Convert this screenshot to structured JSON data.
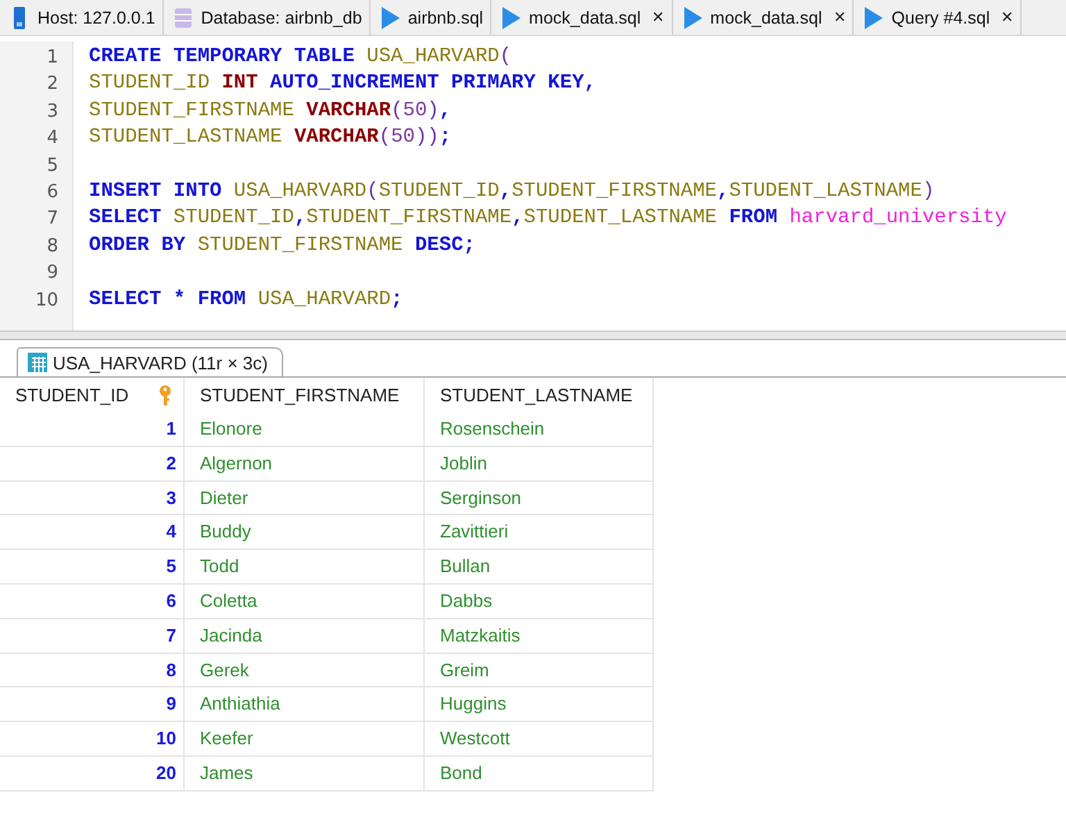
{
  "tabs": [
    {
      "kind": "host",
      "label": "Host: 127.0.0.1"
    },
    {
      "kind": "database",
      "label": "Database: airbnb_db"
    },
    {
      "kind": "file",
      "label": "airbnb.sql"
    },
    {
      "kind": "file",
      "label": "mock_data.sql",
      "close": "✕"
    },
    {
      "kind": "file",
      "label": "mock_data.sql",
      "close": "✕"
    },
    {
      "kind": "file",
      "label": "Query #4.sql",
      "close": "✕"
    }
  ],
  "editor": {
    "lines": [
      {
        "number": "1",
        "tokens": [
          {
            "kind": "keyword",
            "text": "CREATE TEMPORARY TABLE "
          },
          {
            "kind": "identifier",
            "text": "USA_HARVARD"
          },
          {
            "kind": "punct",
            "text": "("
          }
        ]
      },
      {
        "number": "2",
        "tokens": [
          {
            "kind": "identifier",
            "text": "STUDENT_ID "
          },
          {
            "kind": "type",
            "text": "INT "
          },
          {
            "kind": "keyword",
            "text": "AUTO_INCREMENT PRIMARY KEY,"
          }
        ]
      },
      {
        "number": "3",
        "tokens": [
          {
            "kind": "identifier",
            "text": "STUDENT_FIRSTNAME "
          },
          {
            "kind": "type",
            "text": "VARCHAR"
          },
          {
            "kind": "punct",
            "text": "("
          },
          {
            "kind": "number",
            "text": "50"
          },
          {
            "kind": "punct",
            "text": ")"
          },
          {
            "kind": "keyword",
            "text": ","
          }
        ]
      },
      {
        "number": "4",
        "tokens": [
          {
            "kind": "identifier",
            "text": "STUDENT_LASTNAME "
          },
          {
            "kind": "type",
            "text": "VARCHAR"
          },
          {
            "kind": "punct",
            "text": "("
          },
          {
            "kind": "number",
            "text": "50"
          },
          {
            "kind": "punct",
            "text": "))"
          },
          {
            "kind": "keyword",
            "text": ";"
          }
        ]
      },
      {
        "number": "5"
      },
      {
        "number": "6",
        "tokens": [
          {
            "kind": "keyword",
            "text": "INSERT INTO "
          },
          {
            "kind": "identifier",
            "text": "USA_HARVARD"
          },
          {
            "kind": "punct",
            "text": "("
          },
          {
            "kind": "identifier",
            "text": "STUDENT_ID"
          },
          {
            "kind": "keyword",
            "text": ","
          },
          {
            "kind": "identifier",
            "text": "STUDENT_FIRSTNAME"
          },
          {
            "kind": "keyword",
            "text": ","
          },
          {
            "kind": "identifier",
            "text": "STUDENT_LASTNAME"
          },
          {
            "kind": "punct",
            "text": ")"
          }
        ]
      },
      {
        "number": "7",
        "tokens": [
          {
            "kind": "keyword",
            "text": "SELECT "
          },
          {
            "kind": "identifier",
            "text": "STUDENT_ID"
          },
          {
            "kind": "keyword",
            "text": ","
          },
          {
            "kind": "identifier",
            "text": "STUDENT_FIRSTNAME"
          },
          {
            "kind": "keyword",
            "text": ","
          },
          {
            "kind": "identifier",
            "text": "STUDENT_LASTNAME "
          },
          {
            "kind": "keyword",
            "text": "FROM "
          },
          {
            "kind": "table",
            "text": "harvard_university"
          }
        ]
      },
      {
        "number": "8",
        "tokens": [
          {
            "kind": "keyword",
            "text": "ORDER BY "
          },
          {
            "kind": "identifier",
            "text": "STUDENT_FIRSTNAME "
          },
          {
            "kind": "keyword",
            "text": "DESC;"
          }
        ]
      },
      {
        "number": "9"
      },
      {
        "number": "10",
        "tokens": [
          {
            "kind": "keyword",
            "text": "SELECT * FROM "
          },
          {
            "kind": "identifier",
            "text": "USA_HARVARD"
          },
          {
            "kind": "keyword",
            "text": ";"
          }
        ]
      }
    ]
  },
  "result_tab": {
    "label": "USA_HARVARD (11r × 3c)"
  },
  "table": {
    "columns": [
      {
        "label": "STUDENT_ID",
        "primary_key": true
      },
      {
        "label": "STUDENT_FIRSTNAME",
        "primary_key": false
      },
      {
        "label": "STUDENT_LASTNAME",
        "primary_key": false
      }
    ],
    "rows": [
      [
        "1",
        "Elonore",
        "Rosenschein"
      ],
      [
        "2",
        "Algernon",
        "Joblin"
      ],
      [
        "3",
        "Dieter",
        "Serginson"
      ],
      [
        "4",
        "Buddy",
        "Zavittieri"
      ],
      [
        "5",
        "Todd",
        "Bullan"
      ],
      [
        "6",
        "Coletta",
        "Dabbs"
      ],
      [
        "7",
        "Jacinda",
        "Matzkaitis"
      ],
      [
        "8",
        "Gerek",
        "Greim"
      ],
      [
        "9",
        "Anthiathia",
        "Huggins"
      ],
      [
        "10",
        "Keefer",
        "Westcott"
      ],
      [
        "20",
        "James",
        "Bond"
      ]
    ]
  }
}
